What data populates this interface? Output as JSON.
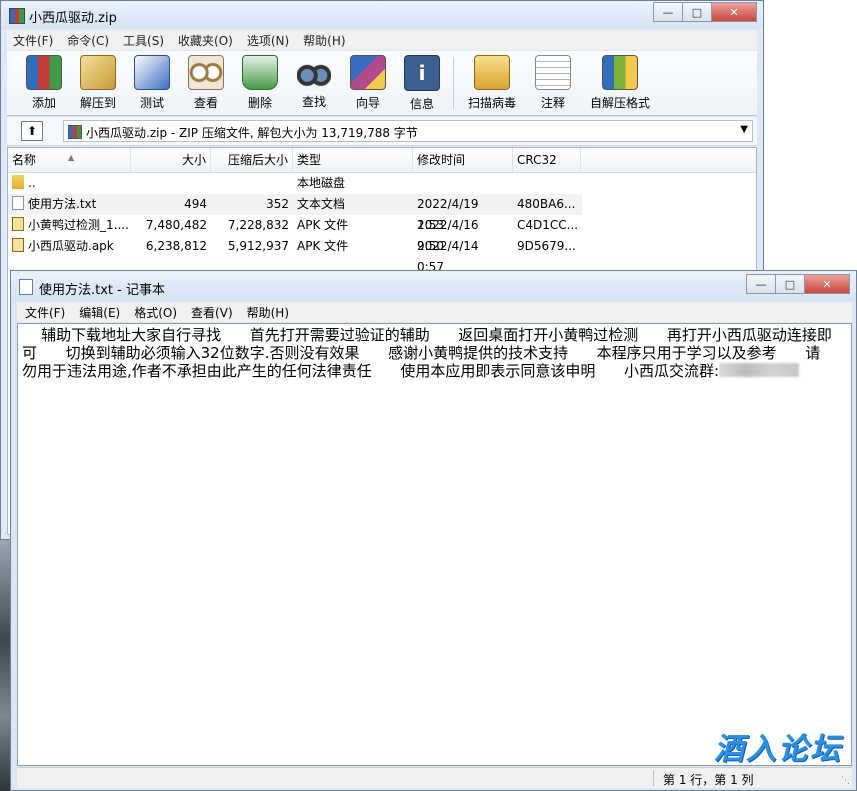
{
  "winrar": {
    "title": "小西瓜驱动.zip",
    "menu": [
      "文件(F)",
      "命令(C)",
      "工具(S)",
      "收藏夹(O)",
      "选项(N)",
      "帮助(H)"
    ],
    "toolbar": [
      {
        "label": "添加",
        "icon": "add-archive-icon",
        "color": "#7b5ca8"
      },
      {
        "label": "解压到",
        "icon": "extract-to-icon",
        "color": "#c79a3a"
      },
      {
        "label": "测试",
        "icon": "test-icon",
        "color": "#3a6cc0"
      },
      {
        "label": "查看",
        "icon": "view-icon",
        "color": "#9a7a45"
      },
      {
        "label": "删除",
        "icon": "delete-icon",
        "color": "#4a9a4a"
      },
      {
        "label": "查找",
        "icon": "find-icon",
        "color": "#444444"
      },
      {
        "label": "向导",
        "icon": "wizard-icon",
        "color": "#b04a8a"
      },
      {
        "label": "信息",
        "icon": "info-icon",
        "color": "#3d5f8f"
      },
      {
        "label": "扫描病毒",
        "icon": "scan-virus-icon",
        "color": "#d9a430"
      },
      {
        "label": "注释",
        "icon": "comment-icon",
        "color": "#c9c9c9"
      },
      {
        "label": "自解压格式",
        "icon": "sfx-icon",
        "color": "#7db03a"
      }
    ],
    "path": "小西瓜驱动.zip - ZIP 压缩文件, 解包大小为 13,719,788 字节",
    "columns": [
      "名称",
      "大小",
      "压缩后大小",
      "类型",
      "修改时间",
      "CRC32"
    ],
    "rows": [
      {
        "name": "..",
        "size": "",
        "packed": "",
        "type": "本地磁盘",
        "modified": "",
        "crc": "",
        "icon": "folder-icon"
      },
      {
        "name": "使用方法.txt",
        "size": "494",
        "packed": "352",
        "type": "文本文档",
        "modified": "2022/4/19 1:53",
        "crc": "480BA6...",
        "icon": "text-file-icon"
      },
      {
        "name": "小黄鸭过检测_1....",
        "size": "7,480,482",
        "packed": "7,228,832",
        "type": "APK 文件",
        "modified": "2022/4/16 9:50",
        "crc": "C4D1CC...",
        "icon": "apk-file-icon"
      },
      {
        "name": "小西瓜驱动.apk",
        "size": "6,238,812",
        "packed": "5,912,937",
        "type": "APK 文件",
        "modified": "2022/4/14 0:57",
        "crc": "9D5679...",
        "icon": "apk-file-icon"
      }
    ]
  },
  "notepad": {
    "title": "使用方法.txt - 记事本",
    "menu": [
      "文件(F)",
      "编辑(E)",
      "格式(O)",
      "查看(V)",
      "帮助(H)"
    ],
    "content": "    辅助下载地址大家自行寻找      首先打开需要过验证的辅助      返回桌面打开小黄鸭过检测      再打开小西瓜驱动连接即可      切换到辅助必须输入32位数字.否则没有效果      感谢小黄鸭提供的技术支持      本程序只用于学习以及参考      请勿用于违法用途,作者不承担由此产生的任何法律责任      使用本应用即表示同意该申明      小西瓜交流群:",
    "status": "第 1 行，第 1 列"
  },
  "watermark": "酒入论坛"
}
